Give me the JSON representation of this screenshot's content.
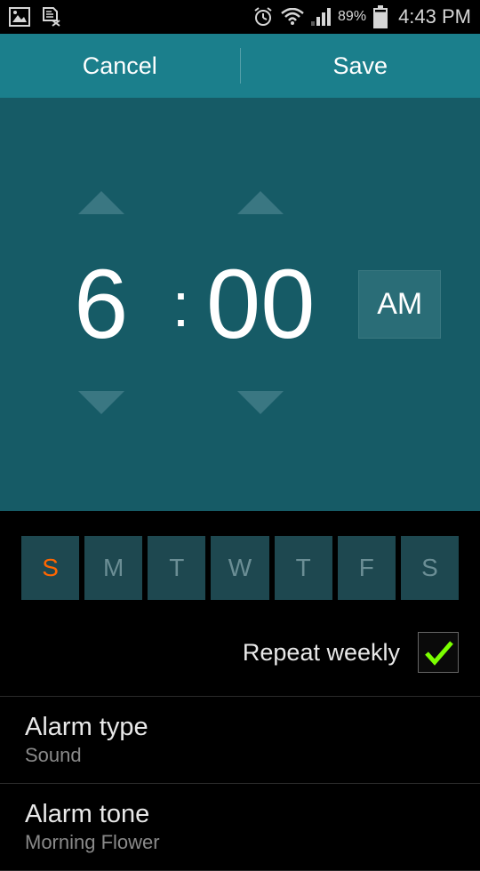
{
  "status": {
    "battery_pct": "89%",
    "time": "4:43 PM"
  },
  "actions": {
    "cancel": "Cancel",
    "save": "Save"
  },
  "time_picker": {
    "hour": "6",
    "minute": "00",
    "ampm": "AM"
  },
  "days": [
    "S",
    "M",
    "T",
    "W",
    "T",
    "F",
    "S"
  ],
  "repeat": {
    "label": "Repeat weekly",
    "checked": true
  },
  "settings": [
    {
      "title": "Alarm type",
      "value": "Sound"
    },
    {
      "title": "Alarm tone",
      "value": "Morning Flower"
    }
  ],
  "colors": {
    "teal_header": "#1b7f8c",
    "teal_body": "#165b66",
    "day_box": "#1e4850",
    "sunday": "#ff6600",
    "check_green": "#7bff00"
  }
}
